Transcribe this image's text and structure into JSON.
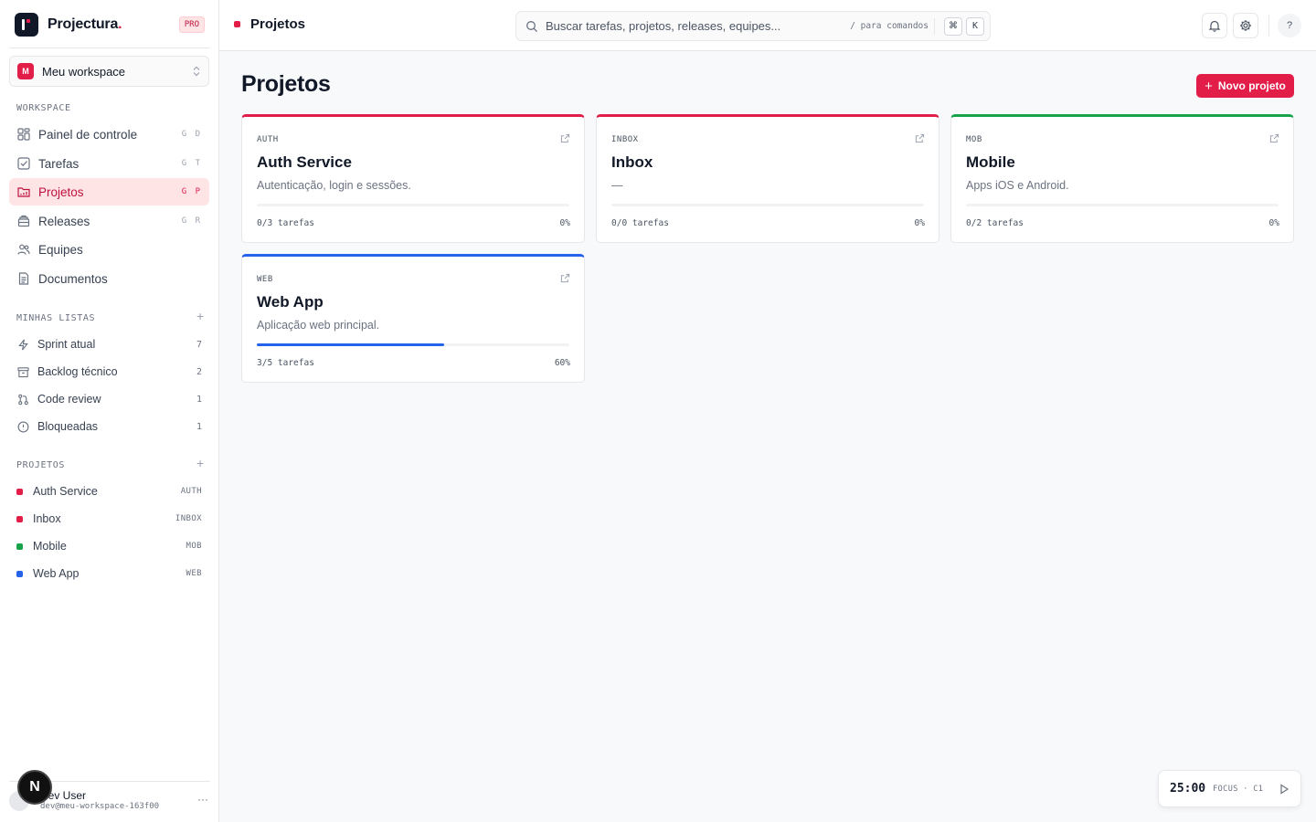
{
  "brand": {
    "name": "Projectura",
    "dot": ".",
    "badge": "PRO"
  },
  "workspace": {
    "avatar": "M",
    "name": "Meu workspace"
  },
  "nav": {
    "section_label": "WORKSPACE",
    "items": [
      {
        "label": "Painel de controle",
        "shortcut": "G D",
        "icon": "dashboard-icon"
      },
      {
        "label": "Tarefas",
        "shortcut": "G T",
        "icon": "checkbox-icon"
      },
      {
        "label": "Projetos",
        "shortcut": "G P",
        "icon": "folder-icon",
        "active": true
      },
      {
        "label": "Releases",
        "shortcut": "G R",
        "icon": "package-icon"
      },
      {
        "label": "Equipes",
        "shortcut": "",
        "icon": "users-icon"
      },
      {
        "label": "Documentos",
        "shortcut": "",
        "icon": "document-icon"
      }
    ]
  },
  "lists": {
    "section_label": "MINHAS LISTAS",
    "add": "+",
    "items": [
      {
        "label": "Sprint atual",
        "count": "7",
        "icon": "lightning-icon"
      },
      {
        "label": "Backlog técnico",
        "count": "2",
        "icon": "archive-icon"
      },
      {
        "label": "Code review",
        "count": "1",
        "icon": "git-pull-icon"
      },
      {
        "label": "Bloqueadas",
        "count": "1",
        "icon": "alert-circle-icon"
      }
    ]
  },
  "projects_nav": {
    "section_label": "PROJETOS",
    "add": "+",
    "items": [
      {
        "label": "Auth Service",
        "key": "AUTH",
        "color": "#e11d48"
      },
      {
        "label": "Inbox",
        "key": "INBOX",
        "color": "#e11d48"
      },
      {
        "label": "Mobile",
        "key": "MOB",
        "color": "#16a34a"
      },
      {
        "label": "Web App",
        "key": "WEB",
        "color": "#2563eb"
      }
    ]
  },
  "user": {
    "name": "Dev User",
    "email": "dev@meu-workspace-163f00",
    "more": "···",
    "next_badge": "N"
  },
  "topbar": {
    "breadcrumb": "Projetos",
    "search_placeholder": "Buscar tarefas, projetos, releases, equipes...",
    "search_hint": "/ para comandos",
    "kbd_cmd": "⌘",
    "kbd_k": "K",
    "help": "?"
  },
  "main": {
    "title": "Projetos",
    "new_button": "Novo projeto",
    "new_button_icon": "+",
    "cards": [
      {
        "key": "AUTH",
        "name": "Auth Service",
        "description": "Autenticação, login e sessões.",
        "tasks": "0/3 tarefas",
        "percent": "0%",
        "progress": 0,
        "color": "#e11d48"
      },
      {
        "key": "INBOX",
        "name": "Inbox",
        "description": "—",
        "tasks": "0/0 tarefas",
        "percent": "0%",
        "progress": 0,
        "color": "#e11d48"
      },
      {
        "key": "MOB",
        "name": "Mobile",
        "description": "Apps iOS e Android.",
        "tasks": "0/2 tarefas",
        "percent": "0%",
        "progress": 0,
        "color": "#16a34a"
      },
      {
        "key": "WEB",
        "name": "Web App",
        "description": "Aplicação web principal.",
        "tasks": "3/5 tarefas",
        "percent": "60%",
        "progress": 0.6,
        "color": "#2563eb"
      }
    ]
  },
  "timer": {
    "time": "25:00",
    "label": "FOCUS · C1"
  }
}
